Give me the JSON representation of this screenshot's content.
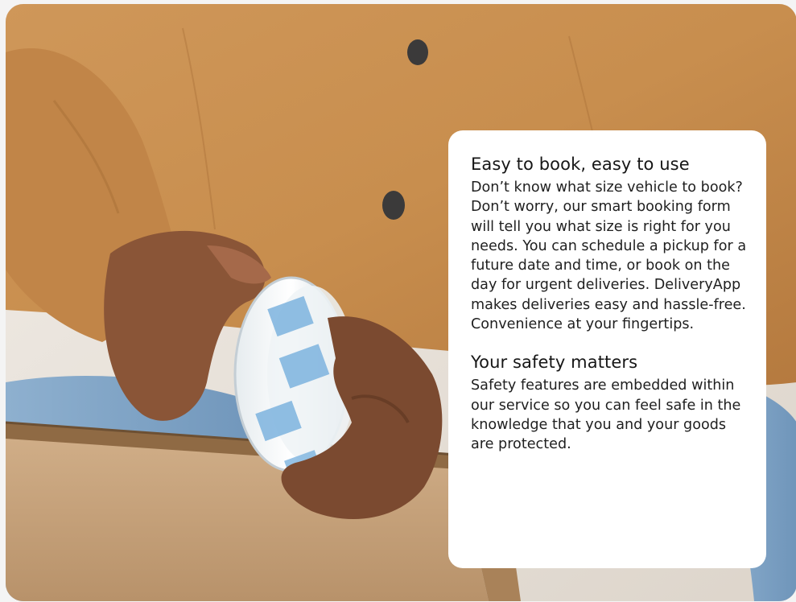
{
  "sections": [
    {
      "heading": "Easy to book, easy to use",
      "body": "Don’t know what size vehicle to book? Don’t worry, our smart booking form will tell you what size is right for you needs. You can schedule a pickup for a future date and time, or book on the day for urgent deliveries. DeliveryApp makes deliveries easy and hassle-free. Convenience at your fingertips."
    },
    {
      "heading": "Your safety matters",
      "body": "Safety features are embedded within our service so you can feel safe in the knowledge that you and your goods are protected."
    }
  ],
  "colors": {
    "card_background": "#ffffff",
    "sweater": "#c88e4e",
    "cardboard": "#c9a47a",
    "jeans": "#7fa4c6"
  }
}
